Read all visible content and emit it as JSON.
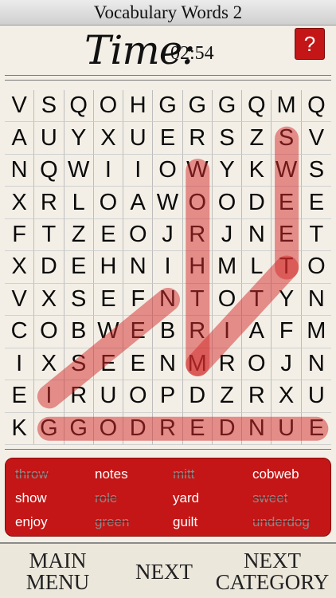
{
  "title": "Vocabulary Words 2",
  "timer": {
    "label": "Time:",
    "value": "02:54"
  },
  "help": {
    "label": "?",
    "icon": "question-icon"
  },
  "grid": [
    [
      "V",
      "S",
      "Q",
      "O",
      "H",
      "G",
      "G",
      "G",
      "Q",
      "M",
      "Q"
    ],
    [
      "A",
      "U",
      "Y",
      "X",
      "U",
      "E",
      "R",
      "S",
      "Z",
      "S",
      "V"
    ],
    [
      "N",
      "Q",
      "W",
      "I",
      "I",
      "O",
      "W",
      "Y",
      "K",
      "W",
      "S"
    ],
    [
      "X",
      "R",
      "L",
      "O",
      "A",
      "W",
      "O",
      "O",
      "D",
      "E",
      "E"
    ],
    [
      "F",
      "T",
      "Z",
      "E",
      "O",
      "J",
      "R",
      "J",
      "N",
      "E",
      "T"
    ],
    [
      "X",
      "D",
      "E",
      "H",
      "N",
      "I",
      "H",
      "M",
      "L",
      "T",
      "O"
    ],
    [
      "V",
      "X",
      "S",
      "E",
      "F",
      "N",
      "T",
      "O",
      "T",
      "Y",
      "N"
    ],
    [
      "C",
      "O",
      "B",
      "W",
      "E",
      "B",
      "R",
      "I",
      "A",
      "F",
      "M"
    ],
    [
      "I",
      "X",
      "S",
      "E",
      "E",
      "N",
      "M",
      "R",
      "O",
      "J",
      "N"
    ],
    [
      "E",
      "I",
      "R",
      "U",
      "O",
      "P",
      "D",
      "Z",
      "R",
      "X",
      "U"
    ],
    [
      "K",
      "G",
      "G",
      "O",
      "D",
      "R",
      "E",
      "D",
      "N",
      "U",
      "E"
    ]
  ],
  "words": [
    {
      "text": "throw",
      "found": true
    },
    {
      "text": "notes",
      "found": false
    },
    {
      "text": "mitt",
      "found": true
    },
    {
      "text": "cobweb",
      "found": false
    },
    {
      "text": "show",
      "found": false
    },
    {
      "text": "role",
      "found": true
    },
    {
      "text": "yard",
      "found": false
    },
    {
      "text": "sweet",
      "found": true
    },
    {
      "text": "enjoy",
      "found": false
    },
    {
      "text": "green",
      "found": true
    },
    {
      "text": "guilt",
      "found": false
    },
    {
      "text": "underdog",
      "found": true
    }
  ],
  "nav": {
    "main_menu": "MAIN\nMENU",
    "next": "NEXT",
    "next_category": "NEXT\nCATEGORY"
  },
  "colors": {
    "accent": "#c41616",
    "highlight": "#d42a2a"
  }
}
